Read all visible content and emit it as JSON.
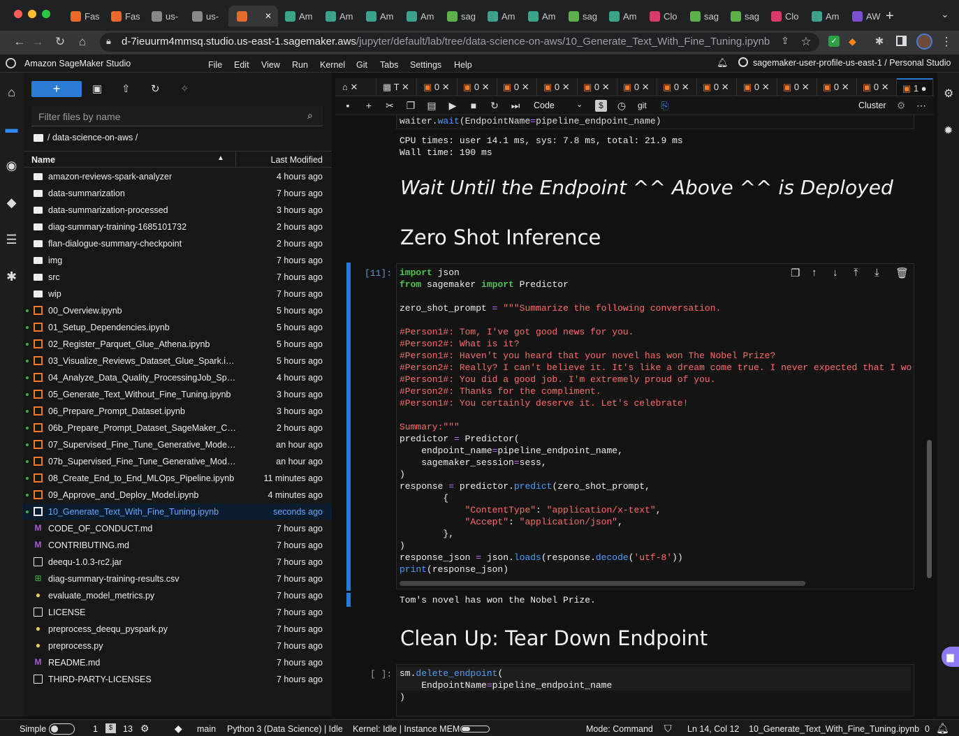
{
  "browser": {
    "tabs": [
      {
        "label": "Fas",
        "color": "#e8692a",
        "active": false
      },
      {
        "label": "Fas",
        "color": "#e8692a",
        "active": false
      },
      {
        "label": "us-",
        "color": "#888888",
        "active": false
      },
      {
        "label": "us-",
        "color": "#888888",
        "active": false
      },
      {
        "label": "",
        "color": "#e8692a",
        "active": true
      },
      {
        "label": "Am",
        "color": "#3aa38a",
        "active": false
      },
      {
        "label": "Am",
        "color": "#3aa38a",
        "active": false
      },
      {
        "label": "Am",
        "color": "#3aa38a",
        "active": false
      },
      {
        "label": "Am",
        "color": "#3aa38a",
        "active": false
      },
      {
        "label": "sag",
        "color": "#5db04a",
        "active": false
      },
      {
        "label": "Am",
        "color": "#3aa38a",
        "active": false
      },
      {
        "label": "Am",
        "color": "#3aa38a",
        "active": false
      },
      {
        "label": "sag",
        "color": "#5db04a",
        "active": false
      },
      {
        "label": "Am",
        "color": "#3aa38a",
        "active": false
      },
      {
        "label": "Clo",
        "color": "#d93a6a",
        "active": false
      },
      {
        "label": "sag",
        "color": "#5db04a",
        "active": false
      },
      {
        "label": "sag",
        "color": "#5db04a",
        "active": false
      },
      {
        "label": "Clo",
        "color": "#d93a6a",
        "active": false
      },
      {
        "label": "Am",
        "color": "#3aa38a",
        "active": false
      },
      {
        "label": "AW",
        "color": "#7a4fd0",
        "active": false
      }
    ],
    "new_tab": "+",
    "url_host": "d-7ieuurm4mmsq.studio.us-east-1.sagemaker.aws",
    "url_path": "/jupyter/default/lab/tree/data-science-on-aws/10_Generate_Text_With_Fine_Tuning.ipynb"
  },
  "studio": {
    "title": "Amazon SageMaker Studio",
    "menu": [
      "File",
      "Edit",
      "View",
      "Run",
      "Kernel",
      "Git",
      "Tabs",
      "Settings",
      "Help"
    ],
    "user": "sagemaker-user-profile-us-east-1 / Personal Studio"
  },
  "filebrowser": {
    "new_label": "+",
    "filter_placeholder": "Filter files by name",
    "breadcrumb": "/ data-science-on-aws /",
    "col_name": "Name",
    "col_modified": "Last Modified",
    "files": [
      {
        "name": "amazon-reviews-spark-analyzer",
        "modified": "4 hours ago",
        "type": "folder",
        "running": false
      },
      {
        "name": "data-summarization",
        "modified": "7 hours ago",
        "type": "folder",
        "running": false
      },
      {
        "name": "data-summarization-processed",
        "modified": "3 hours ago",
        "type": "folder",
        "running": false
      },
      {
        "name": "diag-summary-training-1685101732",
        "modified": "2 hours ago",
        "type": "folder",
        "running": false
      },
      {
        "name": "flan-dialogue-summary-checkpoint",
        "modified": "2 hours ago",
        "type": "folder",
        "running": false
      },
      {
        "name": "img",
        "modified": "7 hours ago",
        "type": "folder",
        "running": false
      },
      {
        "name": "src",
        "modified": "7 hours ago",
        "type": "folder",
        "running": false
      },
      {
        "name": "wip",
        "modified": "7 hours ago",
        "type": "folder",
        "running": false
      },
      {
        "name": "00_Overview.ipynb",
        "modified": "5 hours ago",
        "type": "notebook",
        "running": true
      },
      {
        "name": "01_Setup_Dependencies.ipynb",
        "modified": "5 hours ago",
        "type": "notebook",
        "running": true
      },
      {
        "name": "02_Register_Parquet_Glue_Athena.ipynb",
        "modified": "5 hours ago",
        "type": "notebook",
        "running": true
      },
      {
        "name": "03_Visualize_Reviews_Dataset_Glue_Spark.ipynb",
        "modified": "5 hours ago",
        "type": "notebook",
        "running": true
      },
      {
        "name": "04_Analyze_Data_Quality_ProcessingJob_Spar...",
        "modified": "4 hours ago",
        "type": "notebook",
        "running": true
      },
      {
        "name": "05_Generate_Text_Without_Fine_Tuning.ipynb",
        "modified": "3 hours ago",
        "type": "notebook",
        "running": true
      },
      {
        "name": "06_Prepare_Prompt_Dataset.ipynb",
        "modified": "3 hours ago",
        "type": "notebook",
        "running": true
      },
      {
        "name": "06b_Prepare_Prompt_Dataset_SageMaker_Clu...",
        "modified": "2 hours ago",
        "type": "notebook",
        "running": true
      },
      {
        "name": "07_Supervised_Fine_Tune_Generative_Model.i...",
        "modified": "an hour ago",
        "type": "notebook",
        "running": true
      },
      {
        "name": "07b_Supervised_Fine_Tune_Generative_Model...",
        "modified": "an hour ago",
        "type": "notebook",
        "running": true
      },
      {
        "name": "08_Create_End_to_End_MLOps_Pipeline.ipynb",
        "modified": "11 minutes ago",
        "type": "notebook",
        "running": true
      },
      {
        "name": "09_Approve_and_Deploy_Model.ipynb",
        "modified": "4 minutes ago",
        "type": "notebook",
        "running": true
      },
      {
        "name": "10_Generate_Text_With_Fine_Tuning.ipynb",
        "modified": "seconds ago",
        "type": "notebook-selected",
        "running": true
      },
      {
        "name": "CODE_OF_CONDUCT.md",
        "modified": "7 hours ago",
        "type": "markdown",
        "running": false
      },
      {
        "name": "CONTRIBUTING.md",
        "modified": "7 hours ago",
        "type": "markdown",
        "running": false
      },
      {
        "name": "deequ-1.0.3-rc2.jar",
        "modified": "7 hours ago",
        "type": "file",
        "running": false
      },
      {
        "name": "diag-summary-training-results.csv",
        "modified": "7 hours ago",
        "type": "csv",
        "running": false
      },
      {
        "name": "evaluate_model_metrics.py",
        "modified": "7 hours ago",
        "type": "python",
        "running": false
      },
      {
        "name": "LICENSE",
        "modified": "7 hours ago",
        "type": "file",
        "running": false
      },
      {
        "name": "preprocess_deequ_pyspark.py",
        "modified": "7 hours ago",
        "type": "python",
        "running": false
      },
      {
        "name": "preprocess.py",
        "modified": "7 hours ago",
        "type": "python",
        "running": false
      },
      {
        "name": "README.md",
        "modified": "7 hours ago",
        "type": "markdown",
        "running": false
      },
      {
        "name": "THIRD-PARTY-LICENSES",
        "modified": "7 hours ago",
        "type": "file",
        "running": false
      }
    ]
  },
  "notebook": {
    "tabs": [
      "⌂ ✕",
      "T ✕",
      "0 ✕",
      "0 ✕",
      "0 ✕",
      "0 ✕",
      "0 ✕",
      "0 ✕",
      "0 ✕",
      "0 ✕",
      "0 ✕",
      "0 ✕",
      "0 ✕",
      "0 ✕",
      "1 ●"
    ],
    "cell_type": "Code",
    "git_label": "git",
    "cluster_label": "Cluster",
    "waiter_line": "waiter.wait(EndpointName=pipeline_endpoint_name)",
    "cpu_times": "CPU times: user 14.1 ms, sys: 7.8 ms, total: 21.9 ms",
    "wall_time": "Wall time: 190 ms",
    "heading_wait": "Wait Until the Endpoint ^^ Above ^^ is Deployed",
    "heading_zero": "Zero Shot Inference",
    "cell_prompt": "[11]:",
    "output_text": "Tom's novel has won the Nobel Prize.",
    "heading_cleanup": "Clean Up: Tear Down Endpoint",
    "cell2_prompt": "[ ]:"
  },
  "statusbar": {
    "mode_simple": "Simple",
    "count1": "1",
    "count2": "13",
    "branch": "main",
    "kernel_name": "Python 3 (Data Science) | Idle",
    "kernel_status": "Kernel: Idle | Instance MEM",
    "mode": "Mode: Command",
    "position": "Ln 14, Col 12",
    "filename": "10_Generate_Text_With_Fine_Tuning.ipynb",
    "notifications": "0"
  }
}
